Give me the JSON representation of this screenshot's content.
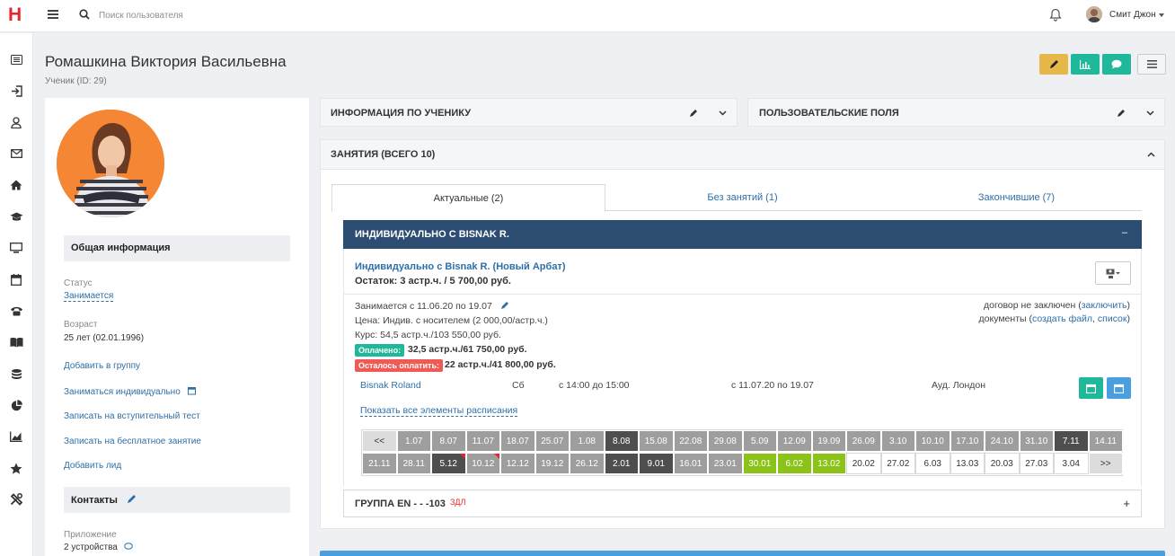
{
  "app": {
    "logo": "H",
    "search_placeholder": "Поиск пользователя",
    "user_name": "Смит Джон"
  },
  "sidebar": [
    "list-icon",
    "login-icon",
    "user-icon",
    "mail-icon",
    "home-icon",
    "graduation-icon",
    "monitor-icon",
    "calendar-icon",
    "phone-icon",
    "book-icon",
    "coins-icon",
    "pie-chart-icon",
    "line-chart-icon",
    "star-icon",
    "tools-icon"
  ],
  "page": {
    "title": "Ромашкина Виктория Васильевна",
    "subtitle": "Ученик (ID: 29)"
  },
  "toolbar": {
    "colors": {
      "edit": "#e6b84a",
      "stats": "#1fb89a",
      "chat": "#1fb89a"
    }
  },
  "profile": {
    "general_title": "Общая информация",
    "status_label": "Статус",
    "status_value": "Занимается",
    "age_label": "Возраст",
    "age_value": "25 лет (02.01.1996)",
    "links": [
      "Добавить в группу",
      "Заниматься индивидуально",
      "Записать на вступительный тест",
      "Записать на бесплатное занятие",
      "Добавить лид"
    ],
    "contacts_title": "Контакты",
    "app_label": "Приложение",
    "app_value": "2 устройства"
  },
  "panels": {
    "student_info": "ИНФОРМАЦИЯ ПО УЧЕНИКУ",
    "custom_fields": "ПОЛЬЗОВАТЕЛЬСКИЕ ПОЛЯ",
    "lessons": "ЗАНЯТИЯ (ВСЕГО 10)"
  },
  "tabs": [
    "Актуальные (2)",
    "Без занятий (1)",
    "Закончившие (7)"
  ],
  "lesson": {
    "bar_title": "ИНДИВИДУАЛЬНО С BISNAK R.",
    "collapse": "–",
    "name": "Индивидуально с Bisnak R. (Новый Арбат)",
    "balance": "Остаток: 3 астр.ч. / 5 700,00 руб.",
    "period": "Занимается с 11.06.20 по 19.07",
    "price": "Цена: Индив. с носителем (2 000,00/астр.ч.)",
    "course": "Курс: 54,5 астр.ч./103 550,00 руб.",
    "paid_badge": "Оплачено:",
    "paid_value": "32,5 астр.ч./61 750,00 руб.",
    "due_badge": "Осталось оплатить:",
    "due_value": "22 астр.ч./41 800,00 руб.",
    "contract_text": "договор не заключен (",
    "contract_link": "заключить",
    "contract_end": ")",
    "docs_text": "документы (",
    "docs_link1": "создать файл",
    "docs_sep": ", ",
    "docs_link2": "список",
    "docs_end": ")",
    "teacher": "Bisnak Roland",
    "day": "Сб",
    "time": "с 14:00 до 15:00",
    "dates": "с 11.07.20 по 19.07",
    "room": "Ауд. Лондон",
    "show_all": "Показать все элементы расписания"
  },
  "schedule": {
    "row1": [
      {
        "t": "<<",
        "s": "nav"
      },
      {
        "t": "1.07",
        "s": "past"
      },
      {
        "t": "8.07",
        "s": "past"
      },
      {
        "t": "11.07",
        "s": "past"
      },
      {
        "t": "18.07",
        "s": "past"
      },
      {
        "t": "25.07",
        "s": "past"
      },
      {
        "t": "1.08",
        "s": "past"
      },
      {
        "t": "8.08",
        "s": "dark"
      },
      {
        "t": "15.08",
        "s": "past"
      },
      {
        "t": "22.08",
        "s": "past"
      },
      {
        "t": "29.08",
        "s": "past"
      },
      {
        "t": "5.09",
        "s": "past"
      },
      {
        "t": "12.09",
        "s": "past"
      },
      {
        "t": "19.09",
        "s": "past"
      },
      {
        "t": "26.09",
        "s": "past"
      },
      {
        "t": "3.10",
        "s": "past"
      },
      {
        "t": "10.10",
        "s": "past"
      },
      {
        "t": "17.10",
        "s": "past"
      },
      {
        "t": "24.10",
        "s": "past"
      },
      {
        "t": "31.10",
        "s": "past"
      },
      {
        "t": "7.11",
        "s": "dark"
      },
      {
        "t": "14.11",
        "s": "past"
      }
    ],
    "row2": [
      {
        "t": "21.11",
        "s": "past"
      },
      {
        "t": "28.11",
        "s": "past"
      },
      {
        "t": "5.12",
        "s": "dark",
        "flag": true
      },
      {
        "t": "10.12",
        "s": "past",
        "flag": true
      },
      {
        "t": "12.12",
        "s": "past"
      },
      {
        "t": "19.12",
        "s": "past"
      },
      {
        "t": "26.12",
        "s": "past"
      },
      {
        "t": "2.01",
        "s": "dark"
      },
      {
        "t": "9.01",
        "s": "dark"
      },
      {
        "t": "16.01",
        "s": "past"
      },
      {
        "t": "23.01",
        "s": "past"
      },
      {
        "t": "30.01",
        "s": "green"
      },
      {
        "t": "6.02",
        "s": "green"
      },
      {
        "t": "13.02",
        "s": "green"
      },
      {
        "t": "20.02",
        "s": "future"
      },
      {
        "t": "27.02",
        "s": "future"
      },
      {
        "t": "6.03",
        "s": "future"
      },
      {
        "t": "13.03",
        "s": "future"
      },
      {
        "t": "20.03",
        "s": "future"
      },
      {
        "t": "27.03",
        "s": "future"
      },
      {
        "t": "3.04",
        "s": "future"
      },
      {
        "t": ">>",
        "s": "nav"
      }
    ]
  },
  "group": {
    "title": "ГРУППА EN - - -103",
    "tag": "ЗДЛ",
    "expand": "+"
  }
}
